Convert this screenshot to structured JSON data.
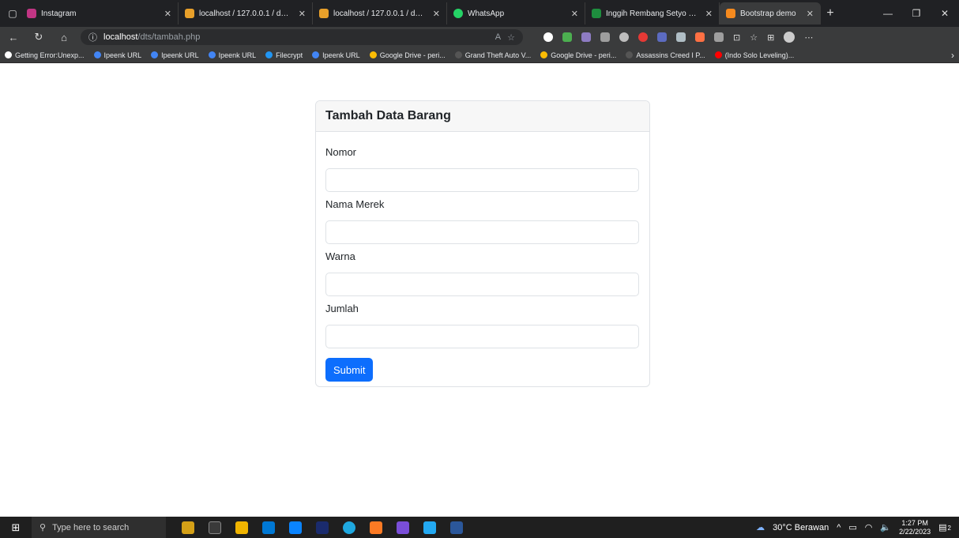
{
  "browser": {
    "tabs": [
      {
        "title": "Instagram",
        "color": "#c13584"
      },
      {
        "title": "localhost / 127.0.0.1 / db_vs",
        "color": "#e8a02a"
      },
      {
        "title": "localhost / 127.0.0.1 / db_vs",
        "color": "#e8a02a"
      },
      {
        "title": "WhatsApp",
        "color": "#25d366"
      },
      {
        "title": "Inggih Rembang Setyo - Go",
        "color": "#1e8e3e"
      },
      {
        "title": "Bootstrap demo",
        "color": "#f68a1e"
      }
    ],
    "url_host": "localhost",
    "url_path": "/dts/tambah.php",
    "bookmarks": [
      {
        "label": "Getting Error:Unexp...",
        "color": "#ffffff"
      },
      {
        "label": "Ipeenk URL",
        "color": "#4285f4"
      },
      {
        "label": "Ipeenk URL",
        "color": "#4285f4"
      },
      {
        "label": "Ipeenk URL",
        "color": "#4285f4"
      },
      {
        "label": "Filecrypt",
        "color": "#2196f3"
      },
      {
        "label": "Ipeenk URL",
        "color": "#4285f4"
      },
      {
        "label": "Google Drive - peri...",
        "color": "#fbbc04"
      },
      {
        "label": "Grand Theft Auto V...",
        "color": "#555555"
      },
      {
        "label": "Google Drive - peri...",
        "color": "#fbbc04"
      },
      {
        "label": "Assassins Creed I P...",
        "color": "#555555"
      },
      {
        "label": "(Indo Solo Leveling)...",
        "color": "#ff0000"
      }
    ]
  },
  "form": {
    "title": "Tambah Data Barang",
    "fields": [
      {
        "label": "Nomor",
        "value": ""
      },
      {
        "label": "Nama Merek",
        "value": ""
      },
      {
        "label": "Warna",
        "value": ""
      },
      {
        "label": "Jumlah",
        "value": ""
      }
    ],
    "submit_label": "Submit",
    "accent": "#0d6efd"
  },
  "taskbar": {
    "search_placeholder": "Type here to search",
    "weather": "30°C Berawan",
    "time": "1:27 PM",
    "date": "2/22/2023",
    "notifications": "2"
  }
}
